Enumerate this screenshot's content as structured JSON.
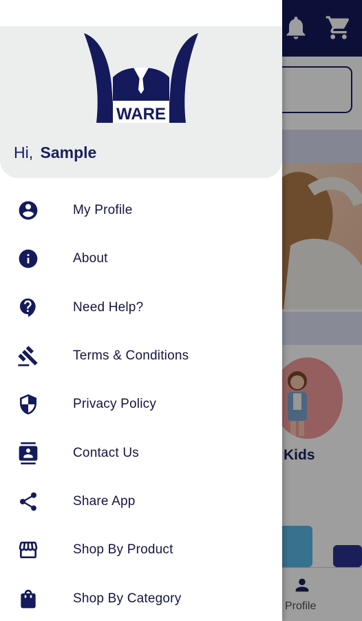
{
  "colors": {
    "brand_navy": "#141a5c",
    "header_bg": "#eceeee",
    "text_dark": "#111640"
  },
  "background": {
    "kids_label": "Kids",
    "bottom_nav_profile": "Profile"
  },
  "drawer": {
    "logo_text": "WARE",
    "greeting_prefix": "Hi,",
    "user_name": "Sample",
    "menu": [
      {
        "label": "My Profile",
        "icon": "account-circle-icon"
      },
      {
        "label": "About",
        "icon": "info-icon"
      },
      {
        "label": "Need Help?",
        "icon": "help-icon"
      },
      {
        "label": "Terms & Conditions",
        "icon": "gavel-icon"
      },
      {
        "label": "Privacy Policy",
        "icon": "shield-icon"
      },
      {
        "label": "Contact Us",
        "icon": "contacts-icon"
      },
      {
        "label": "Share App",
        "icon": "share-icon"
      },
      {
        "label": "Shop By Product",
        "icon": "storefront-icon"
      },
      {
        "label": "Shop By Category",
        "icon": "shopping-bag-icon"
      }
    ]
  }
}
